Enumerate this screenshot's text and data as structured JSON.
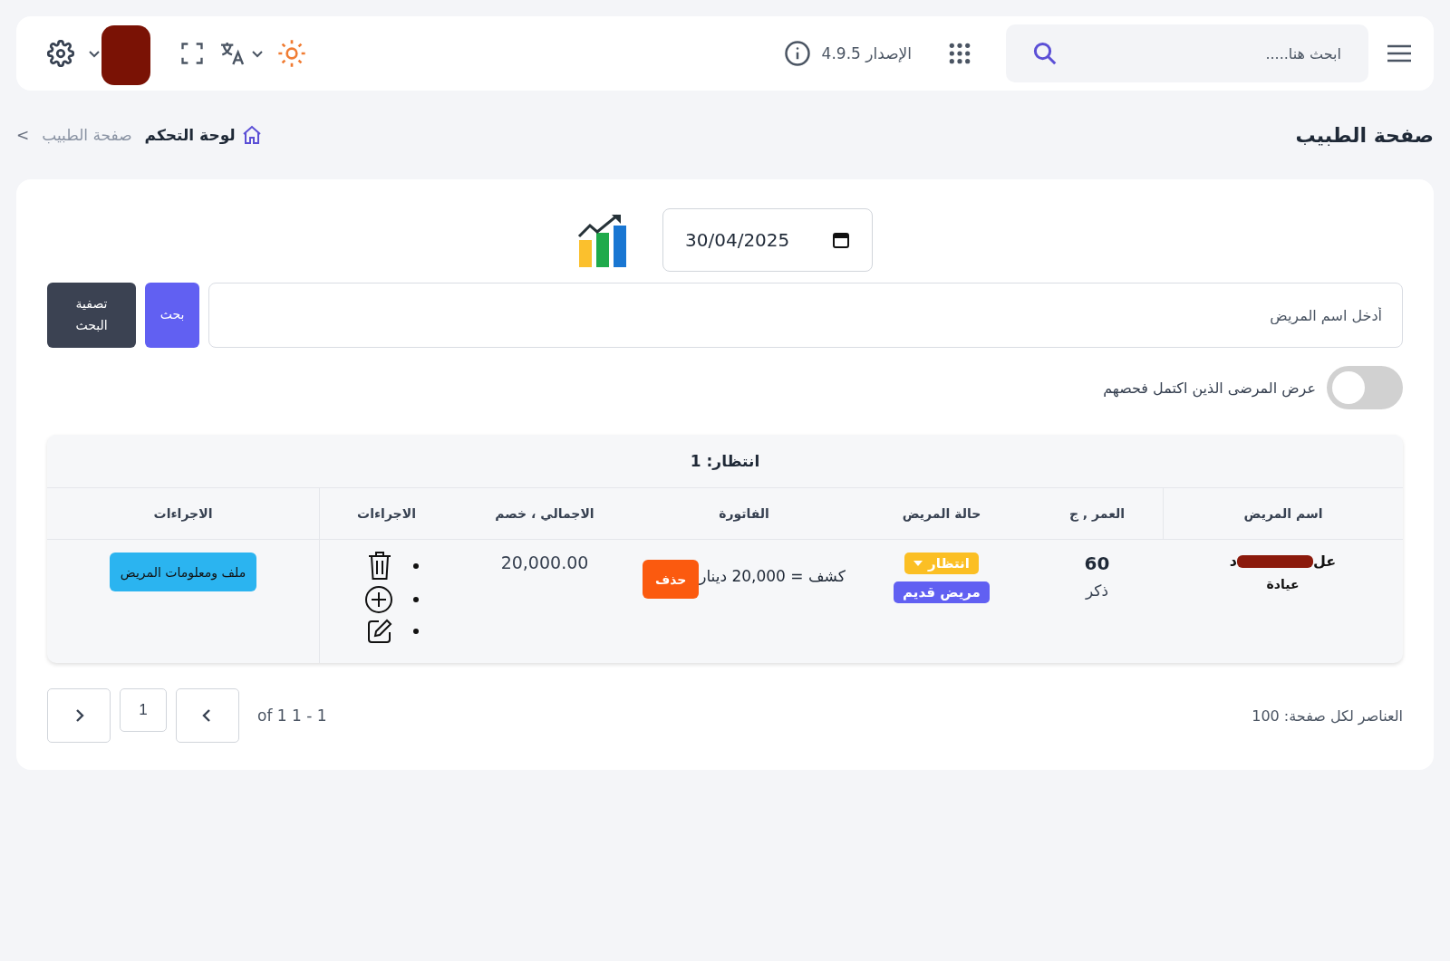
{
  "header": {
    "search": {
      "placeholder": "ابحث هنا....."
    },
    "version": "الإصدار 4.9.5"
  },
  "page_title": "صفحة الطبيب",
  "breadcrumb": [
    {
      "label": "لوحة التحكم",
      "kind": "home"
    },
    {
      "label": "صفحة الطبيب",
      "kind": "page"
    },
    {
      "label": ">",
      "kind": "separator"
    }
  ],
  "filters": {
    "date": "30/04/2025",
    "patient_search": {
      "placeholder": "أدخل اسم المريض"
    },
    "buttons": [
      {
        "label": "بحث",
        "kind": "primary"
      },
      {
        "label": "تصفية البحث",
        "kind": "dark"
      }
    ],
    "show_completed": {
      "label": "عرض المرضى الذين اكتمل فحصهم",
      "on": false
    }
  },
  "table": {
    "title": "انتظار: 1",
    "columns": [
      "اسم المريض",
      "العمر , ج",
      "حالة المريض",
      "الفاتورة",
      "الاجمالي ، خصم",
      "الاجراءات",
      "الاجراءات"
    ],
    "rows": [
      {
        "name_start": "عل",
        "name_end": "د",
        "visit_type": "عيادة",
        "age": "60",
        "gender": "ذكر",
        "status": "انتظار",
        "patient_type": "مريض قديم",
        "invoice": "كشف = 20,000 دينار",
        "invoice_action": "حذف",
        "total": "20,000.00",
        "file_button": "ملف ومعلومات المريض"
      }
    ]
  },
  "pagination": {
    "per_page": "العناصر لكل صفحة: 100",
    "range": "of 1 1 - 1",
    "page": "1"
  }
}
